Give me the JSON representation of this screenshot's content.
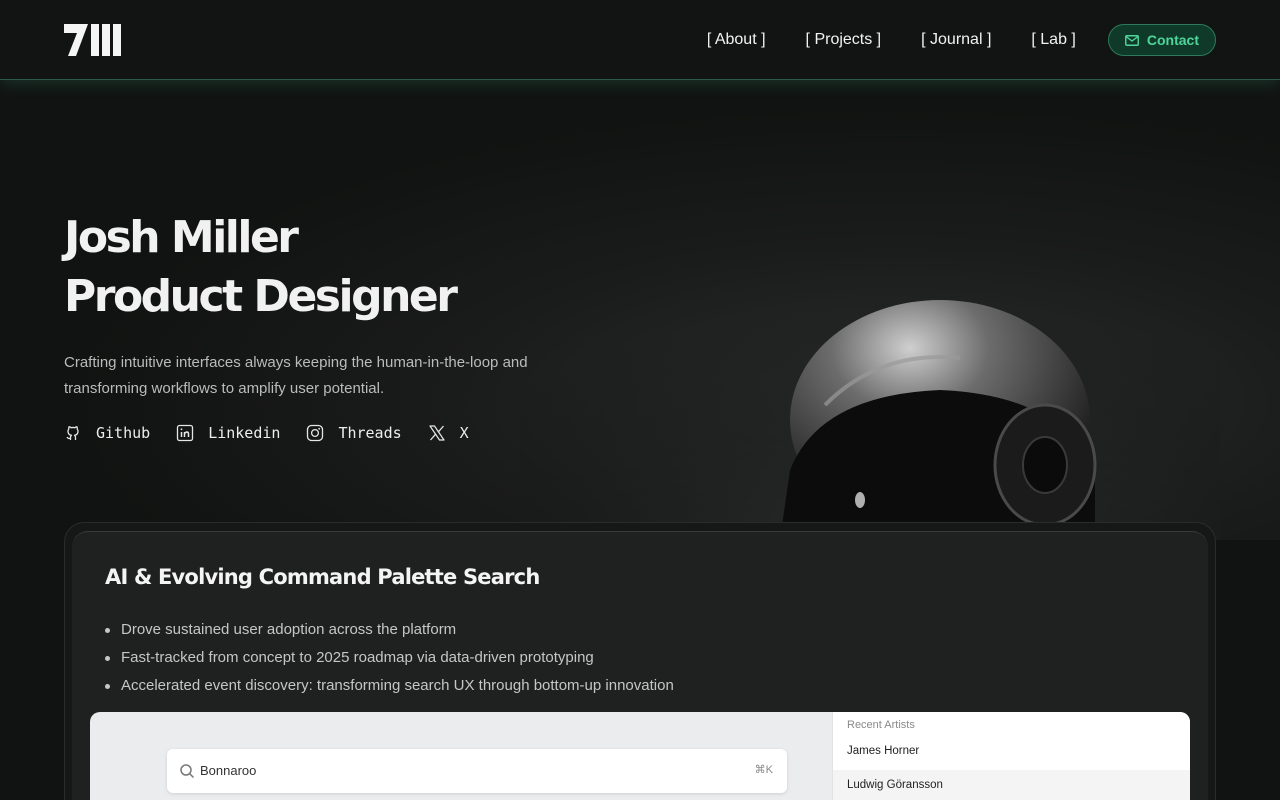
{
  "header": {
    "logo_text": "JM",
    "nav": [
      {
        "label": "[ About ]"
      },
      {
        "label": "[ Projects ]"
      },
      {
        "label": "[ Journal ]"
      },
      {
        "label": "[ Lab ]"
      }
    ],
    "contact_label": "Contact",
    "accent_color": "#4fd59a"
  },
  "hero": {
    "name": "Josh Miller",
    "role": "Product Designer",
    "description": "Crafting intuitive interfaces always keeping the human-in-the-loop and transforming workflows to amplify user potential.",
    "socials": [
      {
        "label": "Github",
        "icon": "github-icon"
      },
      {
        "label": "Linkedin",
        "icon": "linkedin-icon"
      },
      {
        "label": "Threads",
        "icon": "instagram-icon"
      },
      {
        "label": "X",
        "icon": "x-icon"
      }
    ]
  },
  "project": {
    "title": "AI & Evolving Command Palette Search",
    "bullets": [
      "Drove sustained user adoption across the platform",
      "Fast-tracked from concept to 2025 roadmap via data-driven prototyping",
      "Accelerated event discovery: transforming search UX through bottom-up innovation"
    ],
    "preview": {
      "search_value": "Bonnaroo",
      "shortcut": "⌘K",
      "recent_heading": "Recent Artists",
      "artists": [
        "James Horner",
        "Ludwig Göransson"
      ]
    }
  }
}
